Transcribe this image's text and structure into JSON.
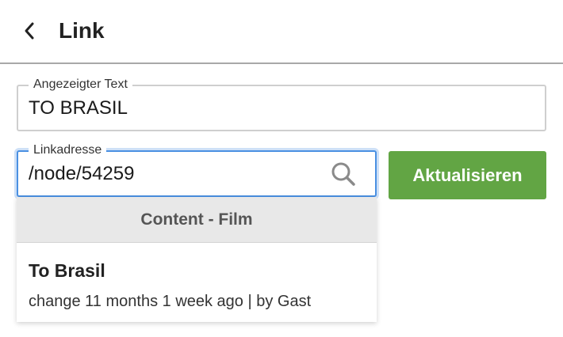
{
  "header": {
    "title": "Link",
    "back_icon": "chevron-left-icon"
  },
  "form": {
    "display_text": {
      "label": "Angezeigter Text",
      "value": "TO BRASIL"
    },
    "link_address": {
      "label": "Linkadresse",
      "value": "/node/54259",
      "search_icon": "magnifier-icon"
    },
    "update_button": "Aktualisieren"
  },
  "autocomplete": {
    "group_label": "Content - Film",
    "results": [
      {
        "title": "To Brasil",
        "meta": "change 11 months 1 week ago | by Gast"
      }
    ]
  },
  "colors": {
    "accent": "#62a544",
    "focus": "#4a90e2",
    "divider": "#a8a8a8",
    "group_bg": "#e8e8e8"
  }
}
